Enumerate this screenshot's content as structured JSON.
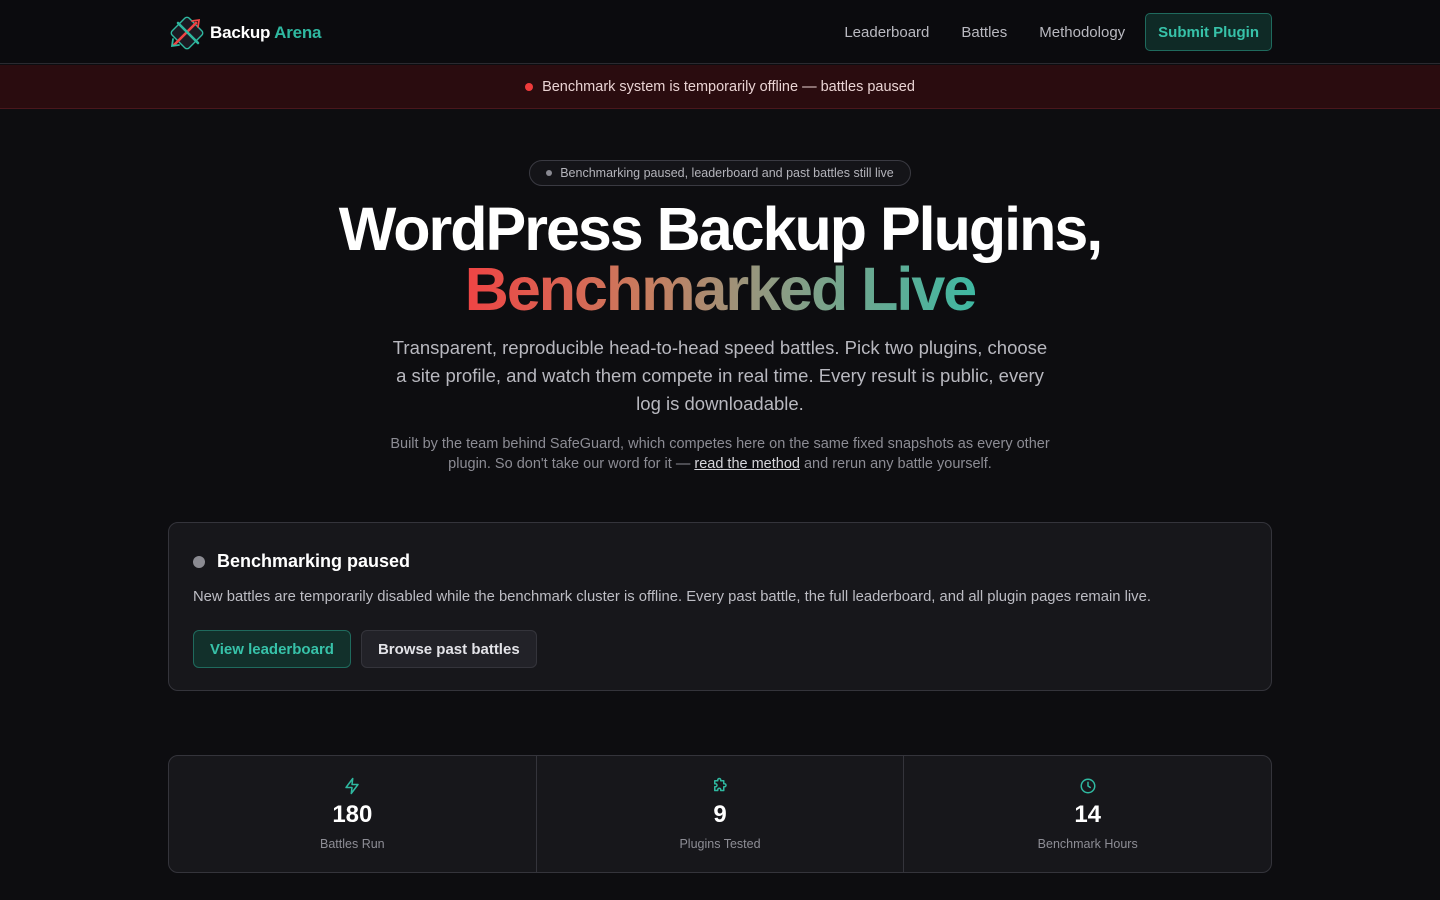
{
  "header": {
    "brand_first": "Backup",
    "brand_second": "Arena",
    "nav": [
      "Leaderboard",
      "Battles",
      "Methodology"
    ],
    "submit_label": "Submit Plugin"
  },
  "banner": {
    "text": "Benchmark system is temporarily offline — battles paused",
    "dot_color": "#ef3b3b"
  },
  "hero": {
    "pill": "Benchmarking paused, leaderboard and past battles still live",
    "title_line1": "WordPress Backup Plugins,",
    "title_line2": "Benchmarked Live",
    "lead": "Transparent, reproducible head-to-head speed battles. Pick two plugins, choose a site profile, and watch them compete in real time. Every result is public, every log is downloadable.",
    "sub_before": "Built by the team behind SafeGuard, which competes here on the same fixed snapshots as every other plugin. So don't take our word for it — ",
    "sub_link": "read the method",
    "sub_after": " and rerun any battle yourself."
  },
  "status_card": {
    "title": "Benchmarking paused",
    "description": "New battles are temporarily disabled while the benchmark cluster is offline. Every past battle, the full leaderboard, and all plugin pages remain live.",
    "primary_button": "View leaderboard",
    "secondary_button": "Browse past battles"
  },
  "stats": [
    {
      "icon": "lightning-icon",
      "value": "180",
      "label": "Battles Run"
    },
    {
      "icon": "puzzle-icon",
      "value": "9",
      "label": "Plugins Tested"
    },
    {
      "icon": "clock-icon",
      "value": "14",
      "label": "Benchmark Hours"
    }
  ],
  "colors": {
    "accent": "#2fb8a0",
    "background": "#0d0d10",
    "gradient_start": "#ef4444",
    "gradient_end": "#3fb8a2"
  }
}
